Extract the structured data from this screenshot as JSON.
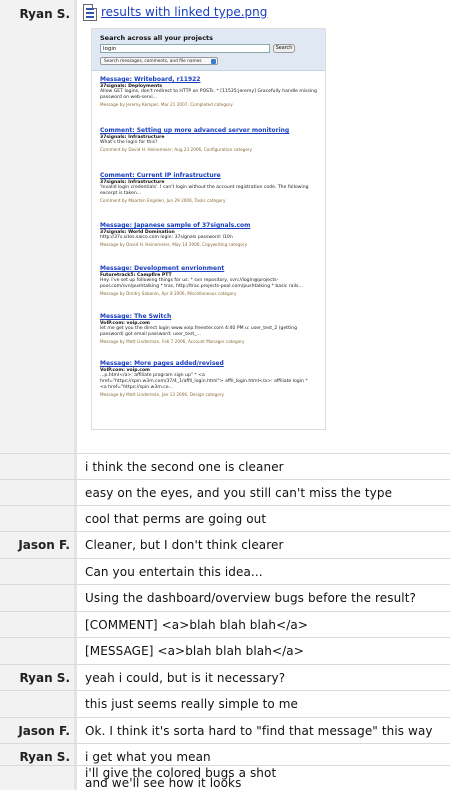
{
  "attachment": {
    "speaker": "Ryan S.",
    "file_name": "results with linked type.png",
    "file_icon": "image-file-icon",
    "screenshot": {
      "search_title": "Search across all your projects",
      "search_value": "login",
      "search_button": "Search",
      "scope_select": "Search messages, comments, and file names",
      "results": [
        {
          "title": "Message: Writeboard, r11922",
          "project": "37signals: Deployments",
          "excerpt": [
            "Allow GET logins, don't redirect to HTTP on POSTs. * [11535:jeremy] Gracefully handle missing",
            "password on web-servi..."
          ],
          "meta": "Message by Jeremy Kemper, Mar 21 2007, Completed category"
        },
        {
          "title": "Comment: Setting up more advanced server monitoring",
          "project": "37signals: Infrastructure",
          "excerpt": [
            "What's the login for this?"
          ],
          "meta": "Comment by David H. Heinemeier, Aug 23 2006, Configuration category"
        },
        {
          "title": "Comment: Current IP infrastructure",
          "project": "37signals: Infrastructure",
          "excerpt": [
            "'Invalid login credentials'. I can't login without the account registration code. The following",
            "excerpt is taken..."
          ],
          "meta": "Comment by Maarten Engelen, Jun 29 2006, Tasks category"
        },
        {
          "title": "Message: Japanese sample of 37signals.com",
          "project": "37signals: World Domination",
          "excerpt": [
            "http://37s.sites.saico.com login: 37signals password: l10n"
          ],
          "meta": "Message by David H. Heinemeier, May 14 2006, Copywriting category"
        },
        {
          "title": "Message: Development envrionment",
          "project": "Futuretrack5: Campfire PTT",
          "excerpt": [
            "Hey. I've set up following things for us: * svn repository, svn://login@projects-",
            "pool.com/svn/pushtalking * trac, http://trac.projects-pool.com/pushtalking * basic rails..."
          ],
          "meta": "Message by Dmitry Sabanin, Apr 8 2006, Miscellaneous category"
        },
        {
          "title": "Message: The Switch",
          "project": "VoIP.com: voip.com",
          "excerpt": [
            "let me get you the direct login www.voip.freester.com 4:40 PM u: user_test_2 (getting",
            "password) got email password: user_test_..."
          ],
          "meta": "Message by Matt Linderman, Feb 7 2006, Account Manager category"
        },
        {
          "title": "Message: More pages added/revised",
          "project": "VoIP.com: voip.com",
          "excerpt": [
            "...p.html</a>: affiliate program sign up\" * <a",
            "href=\"https://spin.w3m.com/37/4_1/affil_login.html\"> affil_login.html</a>: affiliate login * ",
            "<a href=\"https://spin.w3m.co..."
          ],
          "meta": "Message by Matt Linderman, Jan 13 2006, Design category"
        }
      ]
    }
  },
  "lines": [
    {
      "speaker": "",
      "text": "i think the second one is cleaner"
    },
    {
      "speaker": "",
      "text": "easy on the eyes, and you still can't miss the type"
    },
    {
      "speaker": "",
      "text": "cool that perms are going out"
    },
    {
      "speaker": "Jason F.",
      "text": "Cleaner, but I don't think clearer"
    },
    {
      "speaker": "",
      "text": "Can you entertain this idea..."
    },
    {
      "speaker": "",
      "text": "Using the dashboard/overview bugs before the result?"
    },
    {
      "speaker": "",
      "text": "[COMMENT] <a>blah blah blah</a>"
    },
    {
      "speaker": "",
      "text": "[MESSAGE] <a>blah blah blah</a>"
    },
    {
      "speaker": "Ryan S.",
      "text": "yeah i could, but is it necessary?"
    },
    {
      "speaker": "",
      "text": "this just seems really simple to me"
    },
    {
      "speaker": "Jason F.",
      "text": "Ok. I think it's sorta hard to \"find that message\" this way"
    },
    {
      "speaker": "Ryan S.",
      "text": "i get what you mean"
    },
    {
      "speaker": "",
      "text": "i'll give the colored bugs a shot"
    },
    {
      "speaker": "",
      "text": "and we'll see how it looks"
    }
  ]
}
